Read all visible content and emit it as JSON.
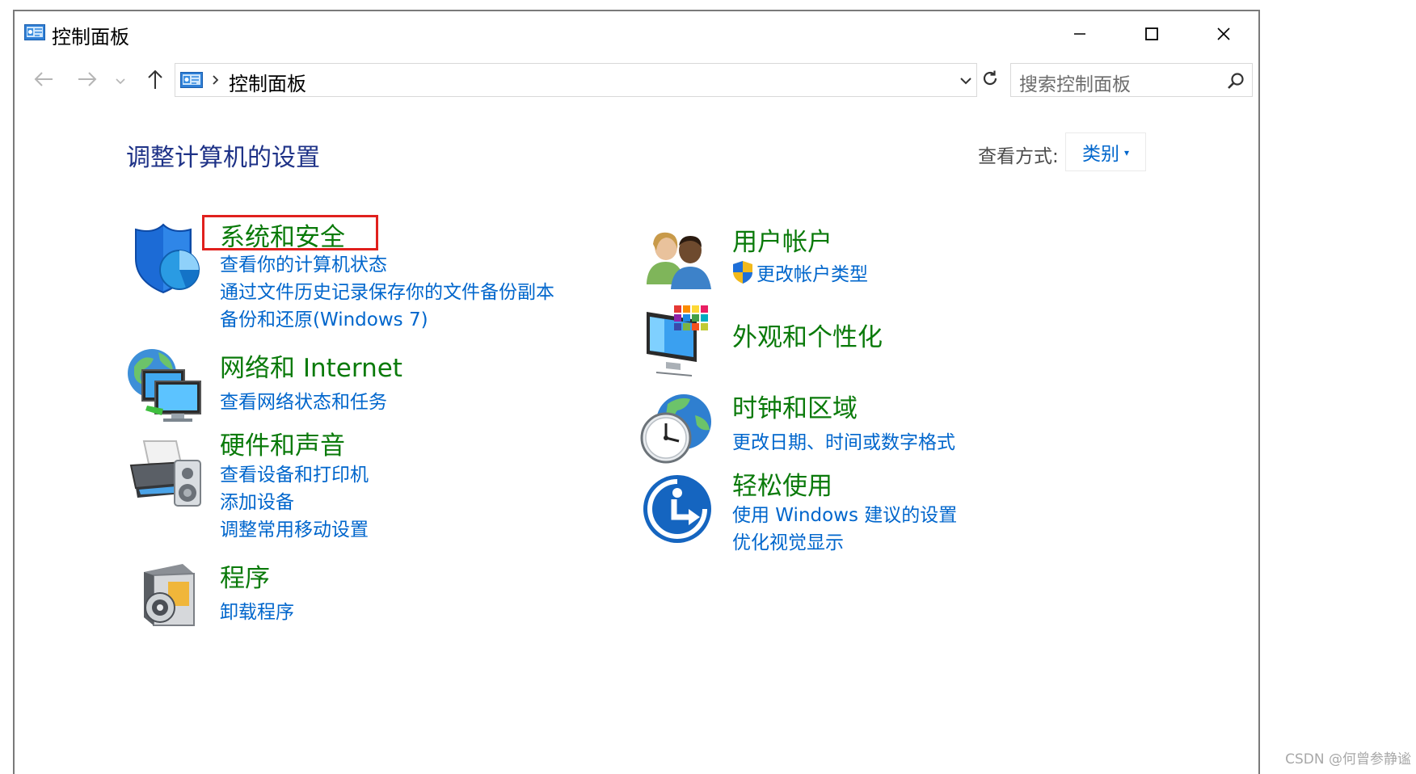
{
  "window": {
    "title": "控制面板",
    "minimize_icon": "minimize-icon",
    "maximize_icon": "maximize-icon",
    "close_icon": "close-icon"
  },
  "nav": {
    "back_icon": "back-arrow-icon",
    "forward_icon": "forward-arrow-icon",
    "recent_icon": "chevron-down-icon",
    "up_icon": "up-arrow-icon",
    "breadcrumb": [
      "控制面板"
    ],
    "refresh_icon": "refresh-icon"
  },
  "search": {
    "placeholder": "搜索控制面板"
  },
  "main": {
    "heading": "调整计算机的设置",
    "view_by_label": "查看方式:",
    "view_by_value": "类别",
    "accent_color": "#0066cc",
    "title_color": "#0a7a0a",
    "highlight_color": "#e0201d"
  },
  "categories": [
    {
      "title": "系统和安全",
      "icon": "shield-chart-icon",
      "highlighted": true,
      "links": [
        "查看你的计算机状态",
        "通过文件历史记录保存你的文件备份副本",
        "备份和还原(Windows 7)"
      ]
    },
    {
      "title": "网络和 Internet",
      "icon": "network-globe-icon",
      "links": [
        "查看网络状态和任务"
      ]
    },
    {
      "title": "硬件和声音",
      "icon": "printer-speaker-icon",
      "links": [
        "查看设备和打印机",
        "添加设备",
        "调整常用移动设置"
      ]
    },
    {
      "title": "程序",
      "icon": "programs-disc-icon",
      "links": [
        "卸载程序"
      ]
    },
    {
      "title": "用户帐户",
      "icon": "users-icon",
      "links": [
        "更改帐户类型"
      ],
      "link_icon": "uac-shield-icon"
    },
    {
      "title": "外观和个性化",
      "icon": "monitor-palette-icon",
      "links": []
    },
    {
      "title": "时钟和区域",
      "icon": "clock-globe-icon",
      "links": [
        "更改日期、时间或数字格式"
      ]
    },
    {
      "title": "轻松使用",
      "icon": "ease-of-access-icon",
      "links": [
        "使用 Windows 建议的设置",
        "优化视觉显示"
      ]
    }
  ],
  "watermark": "CSDN @何曾参静谧"
}
